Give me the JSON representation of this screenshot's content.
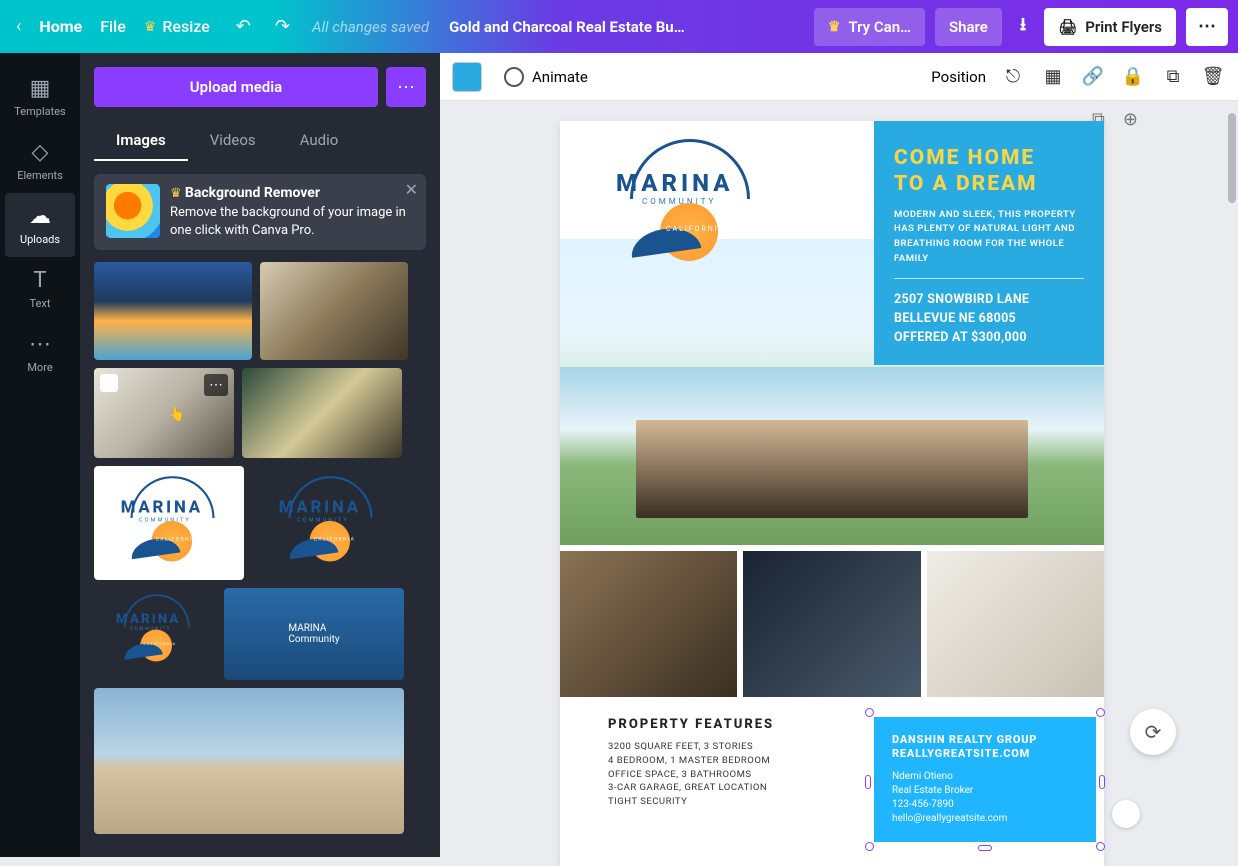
{
  "topbar": {
    "home": "Home",
    "file": "File",
    "resize": "Resize",
    "saved": "All changes saved",
    "doc_title": "Gold and Charcoal Real Estate Bu…",
    "try": "Try Can…",
    "share": "Share",
    "print": "Print Flyers"
  },
  "rail": {
    "templates": "Templates",
    "elements": "Elements",
    "uploads": "Uploads",
    "text": "Text",
    "more": "More"
  },
  "panel": {
    "upload": "Upload media",
    "tabs": {
      "images": "Images",
      "videos": "Videos",
      "audio": "Audio"
    },
    "bg_remover": {
      "title": "Background Remover",
      "desc": "Remove the background of your image in one click with Canva Pro."
    }
  },
  "ctrlbar": {
    "animate": "Animate",
    "position": "Position"
  },
  "flyer": {
    "logo": {
      "name": "MARINA",
      "sub": "COMMUNITY",
      "loc": "CALIFORNIA"
    },
    "headline1": "COME HOME",
    "headline2": "TO A DREAM",
    "desc": "MODERN AND SLEEK, THIS PROPERTY HAS PLENTY OF NATURAL LIGHT AND BREATHING ROOM FOR THE WHOLE FAMILY",
    "addr1": "2507 SNOWBIRD LANE",
    "addr2": "BELLEVUE NE 68005",
    "addr3": "OFFERED AT $300,000",
    "features_title": "PROPERTY FEATURES",
    "f1": "3200 SQUARE FEET, 3 STORIES",
    "f2": "4 BEDROOM, 1 MASTER BEDROOM",
    "f3": "OFFICE SPACE, 3 BATHROOMS",
    "f4": "3-CAR GARAGE, GREAT LOCATION",
    "f5": "TIGHT SECURITY",
    "contact_co": "DANSHIN REALTY GROUP",
    "contact_site": "REALLYGREATSITE.COM",
    "agent": "Ndemi Otieno",
    "role": "Real Estate Broker",
    "phone": "123-456-7890",
    "email": "hello@reallygreatsite.com"
  }
}
